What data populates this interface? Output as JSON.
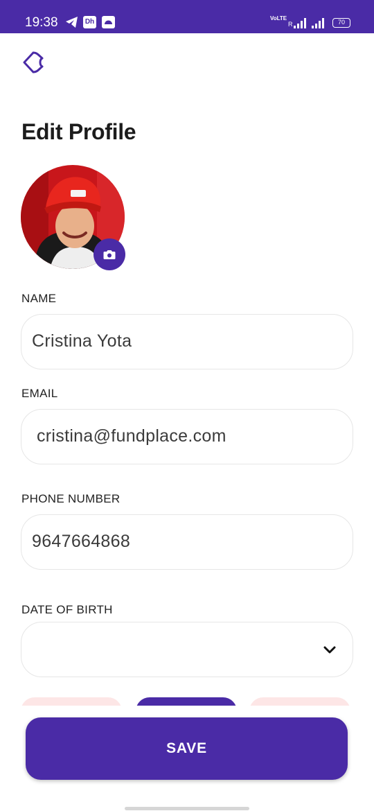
{
  "status_bar": {
    "time": "19:38",
    "app_badge": "Dh",
    "network": "VoLTE",
    "roaming": "R",
    "battery": "70"
  },
  "page": {
    "title": "Edit Profile"
  },
  "form": {
    "name": {
      "label": "NAME",
      "value": "Cristina Yota"
    },
    "email": {
      "label": "EMAIL",
      "value": "cristina@fundplace.com"
    },
    "phone": {
      "label": "PHONE NUMBER",
      "value": "9647664868"
    },
    "dob": {
      "label": "DATE OF BIRTH",
      "value": ""
    }
  },
  "actions": {
    "save_label": "SAVE"
  },
  "colors": {
    "accent": "#4a2ba6",
    "chip_light": "#fde6e6",
    "field_border": "#e6e6e6"
  }
}
